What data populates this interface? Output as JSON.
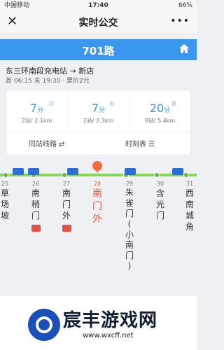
{
  "status": {
    "carrier": "中国移动",
    "time": "17:40",
    "battery": "66%"
  },
  "topbar": {
    "title": "实时公交",
    "more": "•••"
  },
  "route": {
    "name": "701路"
  },
  "direction": {
    "text": "东三环南段充电站 → 新店",
    "times": "首 06:15 末 19:30 · 票价2元"
  },
  "eta": [
    {
      "minutes": "7",
      "unit": "分",
      "detail": "2站/ 2.1km"
    },
    {
      "minutes": "7",
      "unit": "分",
      "detail": "2站/ 2.3km"
    },
    {
      "minutes": "20",
      "unit": "分",
      "detail": "9站/ 5.4km"
    }
  ],
  "actions": {
    "same_station": "同站线路",
    "timetable": "时刻表"
  },
  "stations": [
    {
      "no": "25",
      "name": "草\n场\n坡",
      "metro": false
    },
    {
      "no": "26",
      "name": "南\n稍\n门",
      "metro": true
    },
    {
      "no": "27",
      "name": "南\n门\n外",
      "metro": true
    },
    {
      "no": "28",
      "name": "南\n门\n外",
      "metro": false,
      "active": true
    },
    {
      "no": "29",
      "name": "朱\n雀\n门\n(\n小\n南\n门\n)",
      "metro": false
    },
    {
      "no": "30",
      "name": "含\n光\n门",
      "metro": false
    },
    {
      "no": "31",
      "name": "西\n南\n城\n角",
      "metro": false
    }
  ],
  "colors": {
    "primary": "#3a97f0",
    "active": "#f05b3d",
    "line": "#8ad35b"
  },
  "icons": {
    "close": "close-icon",
    "more": "more-icon",
    "home": "home-icon",
    "wifi": "signal-icon",
    "metro": "metro-icon",
    "bus": "bus-icon",
    "marker": "location-marker-icon"
  },
  "watermark": {
    "title": "宸丰游戏网",
    "url": "www.wxcff.net"
  }
}
